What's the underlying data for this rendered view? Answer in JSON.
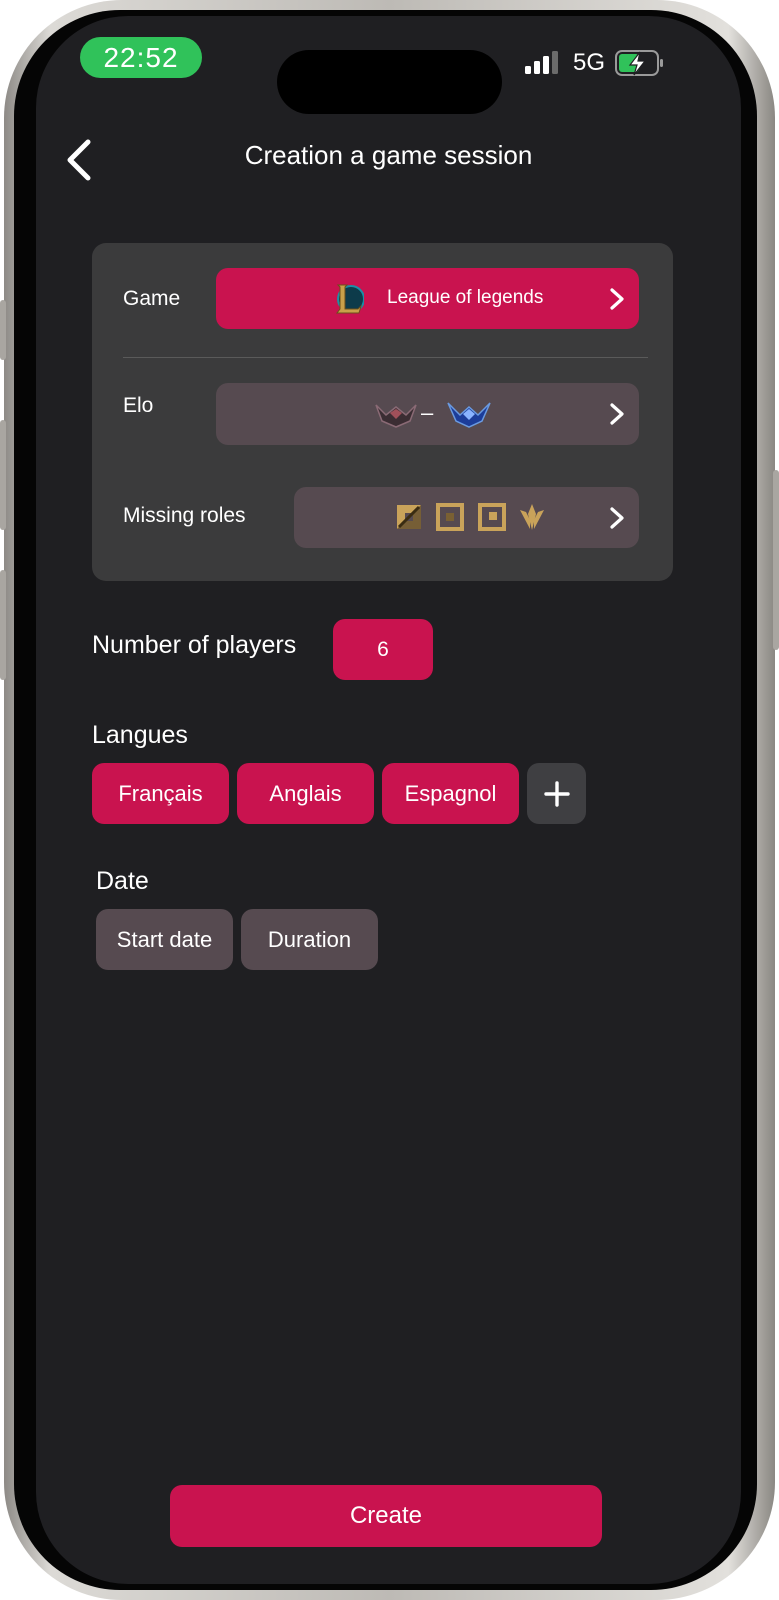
{
  "status_bar": {
    "time": "22:52",
    "network": "5G",
    "signal_icon": "cellular-signal-icon",
    "battery_icon": "battery-charging-icon"
  },
  "nav": {
    "title": "Creation a game session",
    "back_icon": "chevron-left-icon"
  },
  "form": {
    "game": {
      "label": "Game",
      "value": "League of legends",
      "icon": "league-of-legends-logo-icon"
    },
    "elo": {
      "label": "Elo",
      "separator": "–",
      "min_icon": "elo-rank-low-icon",
      "max_icon": "elo-rank-high-icon"
    },
    "missing_roles": {
      "label": "Missing roles",
      "icons": [
        "role-top-icon",
        "role-jungle-icon",
        "role-mid-icon",
        "role-support-icon"
      ]
    }
  },
  "players": {
    "label": "Number of players",
    "value": "6"
  },
  "languages": {
    "label": "Langues",
    "items": [
      "Français",
      "Anglais",
      "Espagnol"
    ],
    "add_icon": "plus-icon"
  },
  "date": {
    "label": "Date",
    "start_label": "Start date",
    "duration_label": "Duration"
  },
  "actions": {
    "create_label": "Create"
  },
  "colors": {
    "accent": "#c9134f",
    "background": "#1f1f22",
    "card": "#3b3b3c",
    "muted_button": "#564a50",
    "status_green": "#30c25a"
  }
}
